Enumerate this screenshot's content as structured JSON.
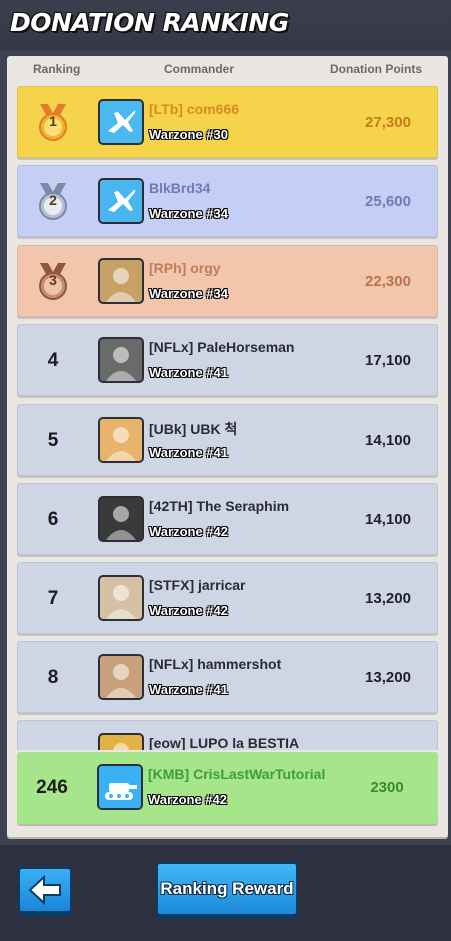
{
  "title": "DONATION RANKING",
  "header": {
    "ranking": "Ranking",
    "commander": "Commander",
    "points": "Donation Points"
  },
  "rows": [
    {
      "rank": "1",
      "medal": "gold-medal-icon",
      "name": "[LTb] com666",
      "zone": "Warzone #30",
      "points": "27,300",
      "bg": "#f5d44c",
      "name_color": "#d9891e",
      "points_color": "#c77a18",
      "avatar": "plane-icon"
    },
    {
      "rank": "2",
      "medal": "silver-medal-icon",
      "name": "BlkBrd34",
      "zone": "Warzone #34",
      "points": "25,600",
      "bg": "#c5cff6",
      "name_color": "#6f7bb3",
      "points_color": "#6f7bb3",
      "avatar": "plane-icon"
    },
    {
      "rank": "3",
      "medal": "bronze-medal-icon",
      "name": "[RPh] orgy",
      "zone": "Warzone #34",
      "points": "22,300",
      "bg": "#f1c6ad",
      "name_color": "#c17c5a",
      "points_color": "#b8724f",
      "avatar": "portrait-icon"
    },
    {
      "rank": "4",
      "name": "[NFLx] PaleHorseman",
      "zone": "Warzone #41",
      "points": "17,100",
      "bg": "#ced5e5",
      "name_color": "#2b2b33",
      "points_color": "#222",
      "avatar": "portrait-icon"
    },
    {
      "rank": "5",
      "name": "[UBk] UBK 척",
      "zone": "Warzone #41",
      "points": "14,100",
      "bg": "#ced5e5",
      "name_color": "#2b2b33",
      "points_color": "#222",
      "avatar": "portrait-icon"
    },
    {
      "rank": "6",
      "name": "[42TH] The Seraphim",
      "zone": "Warzone #42",
      "points": "14,100",
      "bg": "#ced5e5",
      "name_color": "#2b2b33",
      "points_color": "#222",
      "avatar": "portrait-icon"
    },
    {
      "rank": "7",
      "name": "[STFX] jarricar",
      "zone": "Warzone #42",
      "points": "13,200",
      "bg": "#ced5e5",
      "name_color": "#2b2b33",
      "points_color": "#222",
      "avatar": "portrait-icon"
    },
    {
      "rank": "8",
      "name": "[NFLx] hammershot",
      "zone": "Warzone #41",
      "points": "13,200",
      "bg": "#ced5e5",
      "name_color": "#2b2b33",
      "points_color": "#222",
      "avatar": "portrait-icon"
    },
    {
      "rank": "",
      "name": "[еоw] LUPO la BESTIA",
      "zone": "",
      "points": "",
      "bg": "#ced5e5",
      "name_color": "#2b2b33",
      "points_color": "#222",
      "avatar": "portrait-icon"
    }
  ],
  "me": {
    "rank": "246",
    "name": "[KMB] CrisLastWarTutorial",
    "zone": "Warzone #42",
    "points": "2300",
    "name_color": "#3f9d3a",
    "points_color": "#3d8a2f",
    "avatar": "tank-icon"
  },
  "buttons": {
    "back_icon": "back-arrow-icon",
    "reward": "Ranking Reward"
  }
}
